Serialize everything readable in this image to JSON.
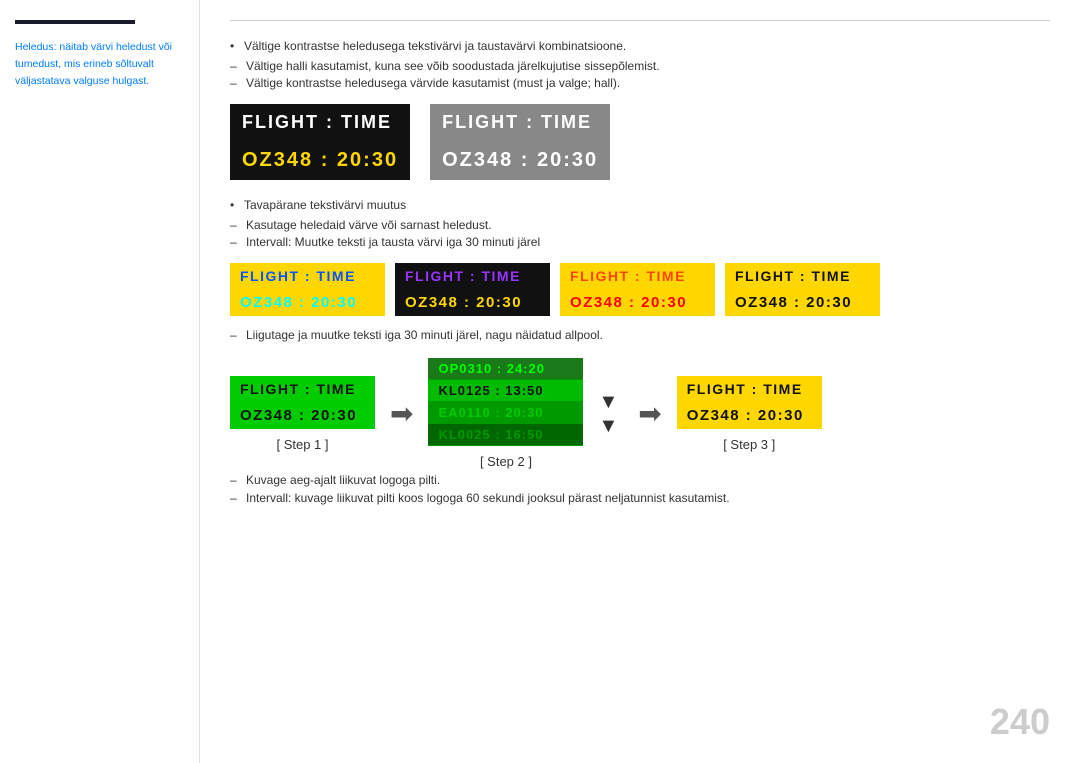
{
  "sidebar": {
    "note": "Heledus: näitab värvi heledust või tumedust, mis erineb sõltuvalt väljastatava valguse hulgast."
  },
  "top_bullets": [
    "Vältige kontrastse heledusega tekstivärvi ja taustavärvi kombinatsioone.",
    "Vältige halli kasutamist, kuna see võib soodustada järelkujutise sissepõlemist.",
    "Vältige kontrastse heledusega värvide kasutamist (must ja valge; hall)."
  ],
  "box1": {
    "header": "FLIGHT  :  TIME",
    "body": "OZ348  :  20:30"
  },
  "box2": {
    "header": "FLIGHT  :  TIME",
    "body": "OZ348  :  20:30"
  },
  "mid_bullets": [
    "Tavapärane tekstivärvi muutus"
  ],
  "mid_dashes": [
    "Kasutage heledaid värve või sarnast heledust.",
    "Intervall: Muutke teksti ja tausta värvi iga 30 minuti järel"
  ],
  "variants": [
    {
      "header": "FLIGHT  :  TIME",
      "body": "OZ348  :  20:30",
      "class": "var1"
    },
    {
      "header": "FLIGHT  :  TIME",
      "body": "OZ348  :  20:30",
      "class": "var2"
    },
    {
      "header": "FLIGHT  :  TIME",
      "body": "OZ348  :  20:30",
      "class": "var3"
    },
    {
      "header": "FLIGHT  :  TIME",
      "body": "OZ348  :  20:30",
      "class": "var4"
    }
  ],
  "move_note": "Liigutage ja muutke teksti iga 30 minuti järel, nagu näidatud allpool.",
  "step1": {
    "header": "FLIGHT  :  TIME",
    "body": "OZ348  :  20:30",
    "label": "[ Step 1 ]"
  },
  "step2": {
    "rows": [
      "OP0310  :  24:20",
      "KL0125  :  13:50",
      "EA0110  :  20:30",
      "KL0025  :  16:50"
    ],
    "label": "[ Step 2 ]"
  },
  "step3": {
    "header": "FLIGHT  :  TIME",
    "body": "OZ348  :  20:30",
    "label": "[ Step 3 ]"
  },
  "bottom_notes": [
    "Kuvage aeg-ajalt liikuvat logoga pilti.",
    "Intervall: kuvage liikuvat pilti koos logoga 60 sekundi jooksul pärast neljatunnist kasutamist."
  ],
  "page_number": "240"
}
